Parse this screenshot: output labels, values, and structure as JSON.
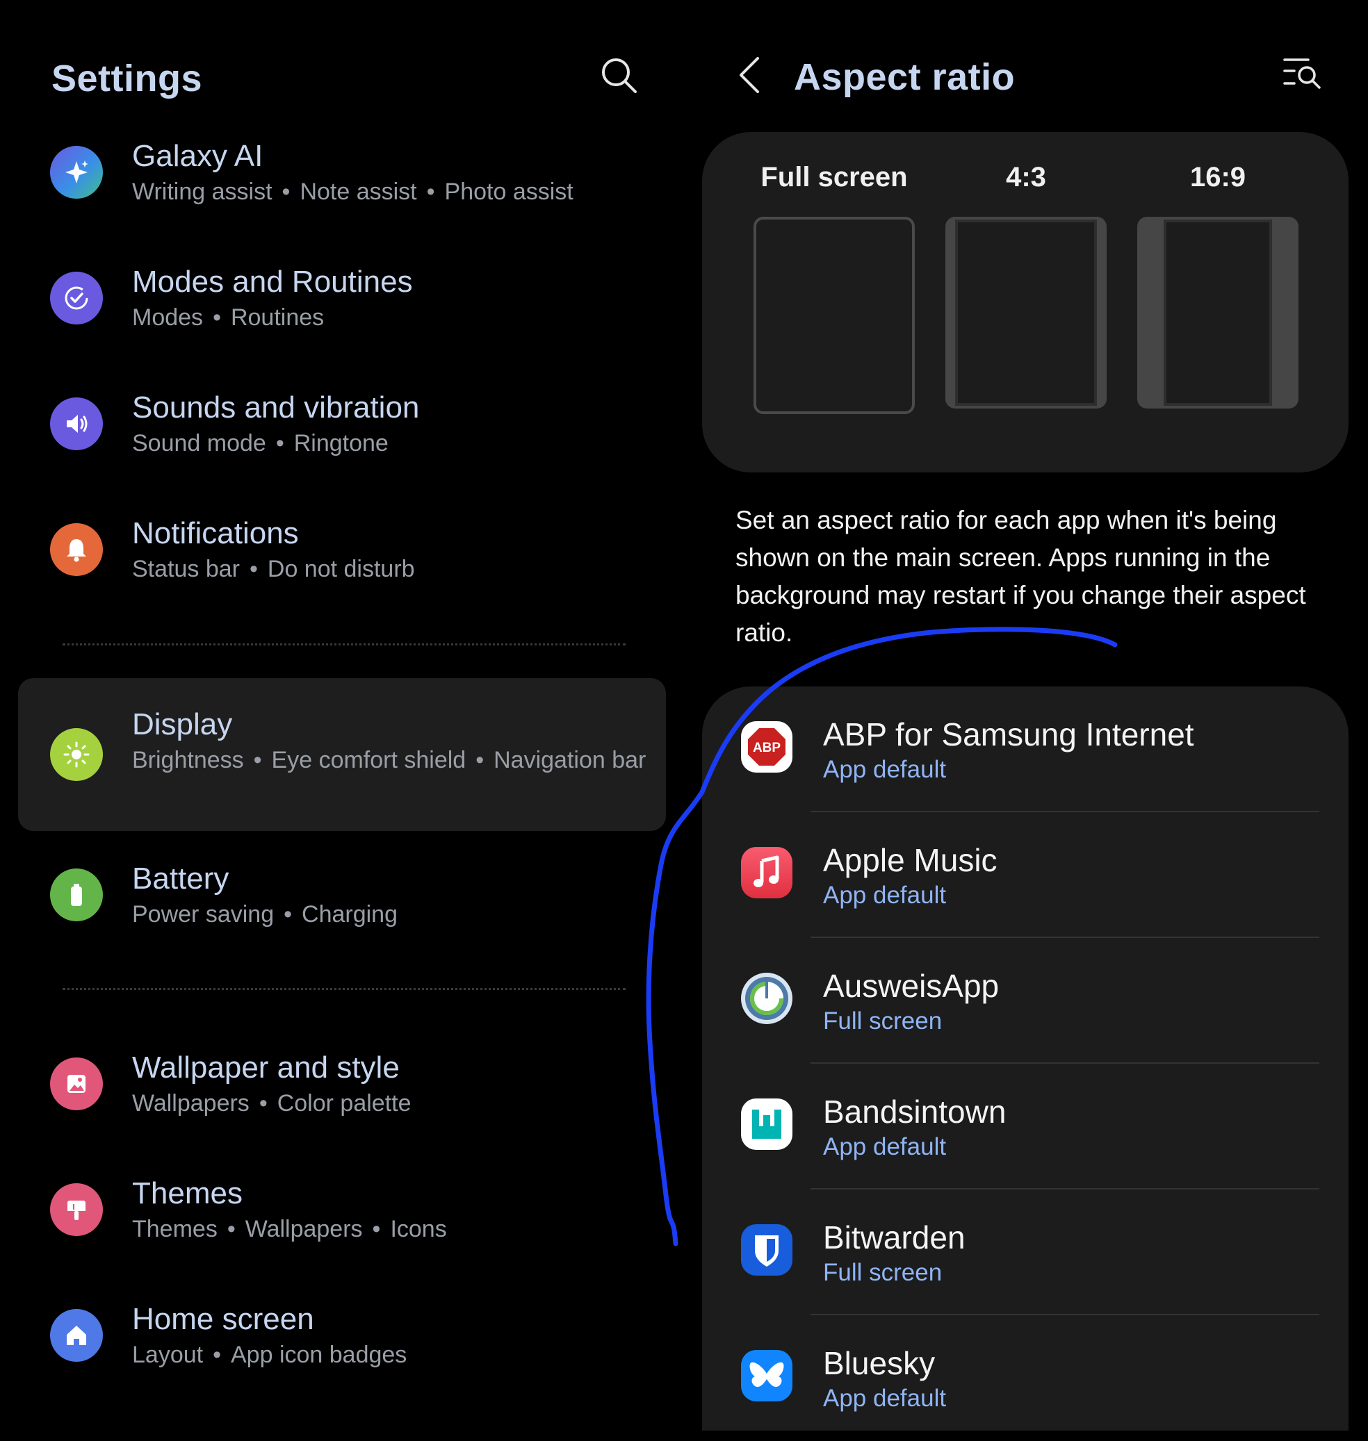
{
  "settings": {
    "title": "Settings",
    "items": [
      {
        "title": "Galaxy AI",
        "sub": [
          "Writing assist",
          "Note assist",
          "Photo assist"
        ],
        "color": "#4f79e6"
      },
      {
        "title": "Modes and Routines",
        "sub": [
          "Modes",
          "Routines"
        ],
        "color": "#6a5ae0"
      },
      {
        "title": "Sounds and vibration",
        "sub": [
          "Sound mode",
          "Ringtone"
        ],
        "color": "#6a5ae0"
      },
      {
        "title": "Notifications",
        "sub": [
          "Status bar",
          "Do not disturb"
        ],
        "color": "#e4683a"
      },
      {
        "title": "Display",
        "sub": [
          "Brightness",
          "Eye comfort shield",
          "Navigation bar"
        ],
        "color": "#a6d13f"
      },
      {
        "title": "Battery",
        "sub": [
          "Power saving",
          "Charging"
        ],
        "color": "#63b54a"
      },
      {
        "title": "Wallpaper and style",
        "sub": [
          "Wallpapers",
          "Color palette"
        ],
        "color": "#e0577a"
      },
      {
        "title": "Themes",
        "sub": [
          "Themes",
          "Wallpapers",
          "Icons"
        ],
        "color": "#e0577a"
      },
      {
        "title": "Home screen",
        "sub": [
          "Layout",
          "App icon badges"
        ],
        "color": "#4f79e6"
      }
    ],
    "selected": "Display"
  },
  "aspect": {
    "title": "Aspect ratio",
    "options": [
      "Full screen",
      "4:3",
      "16:9"
    ],
    "description": "Set an aspect ratio for each app when it's being shown on the main screen. Apps running in the background may restart if you change their aspect ratio.",
    "apps": [
      {
        "name": "ABP for Samsung Internet",
        "value": "App default",
        "icon": "abp-icon"
      },
      {
        "name": "Apple Music",
        "value": "App default",
        "icon": "apple-music-icon"
      },
      {
        "name": "AusweisApp",
        "value": "Full screen",
        "icon": "ausweisapp-icon"
      },
      {
        "name": "Bandsintown",
        "value": "App default",
        "icon": "bandsintown-icon"
      },
      {
        "name": "Bitwarden",
        "value": "Full screen",
        "icon": "bitwarden-icon"
      },
      {
        "name": "Bluesky",
        "value": "App default",
        "icon": "bluesky-icon"
      }
    ],
    "abp_badge": "ABP"
  },
  "colors": {
    "accent_text": "#8fb4f4",
    "title_text": "#c7d6f0",
    "annotation": "#1b3cf5"
  }
}
